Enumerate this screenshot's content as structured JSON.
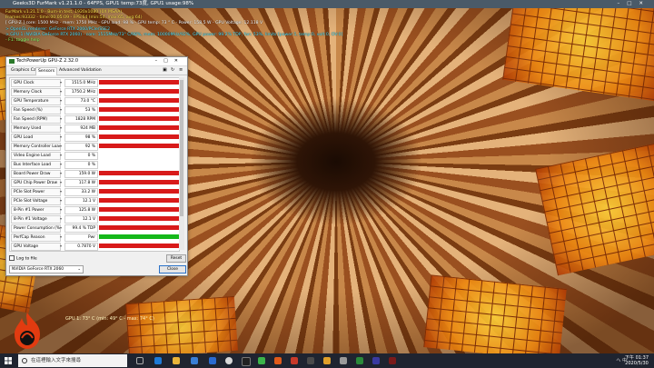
{
  "furmark": {
    "window_title": "Geeks3D FurMark v1.21.1.0 - 64FPS, GPU1 temp:73度, GPU1 usage:98%",
    "info_lines": [
      "FurMark v1.21.1.0 - Burn-in test, 1920x1080 (0X MSAA)",
      "Frames:93332 - time:00:05:09 - FPS:64 (min:54, max:65, avg:64)",
      "[ GPU-Z ] core: 1500 MHz - mem: 1750 MHz - GPU load: 98 % - GPU temp: 73 ° C - Power: 158.5 W - GPU Voltage: 12.118 V",
      "> OpenGL renderer: GeForce RTX 2060/PCIe/SSE2",
      "> GPU 1 (NVIDIA GeForce RTX 2060) - core: 1515MHz/73° C/98%, mem: 10000MHz/92%, GPU power: 99.2% TDP, fan: 53%, limits:[power:1, temp:0, volt:0, OV:0]",
      "- F1: toggle help"
    ],
    "gpu_overlay": "GPU 1: 73° C (min: 49° C - max: 74° C)"
  },
  "gpuz": {
    "title": "TechPowerUp GPU-Z 2.32.0",
    "tabs": [
      "Graphics Card",
      "Sensors",
      "Advanced",
      "Validation"
    ],
    "active_tab": "Sensors",
    "sensors": [
      {
        "label": "GPU Clock",
        "value": "1515.0 MHz",
        "fill": 0.98
      },
      {
        "label": "Memory Clock",
        "value": "1750.2 MHz",
        "fill": 0.98
      },
      {
        "label": "GPU Temperature",
        "value": "73.0 °C",
        "fill": 0.98
      },
      {
        "label": "Fan Speed (%)",
        "value": "53 %",
        "fill": 0.98
      },
      {
        "label": "Fan Speed (RPM)",
        "value": "1828 RPM",
        "fill": 0.98
      },
      {
        "label": "Memory Used",
        "value": "924 MB",
        "fill": 0.98
      },
      {
        "label": "GPU Load",
        "value": "98 %",
        "fill": 0.98
      },
      {
        "label": "Memory Controller Load",
        "value": "92 %",
        "fill": 0.98
      },
      {
        "label": "Video Engine Load",
        "value": "0 %",
        "fill": 0
      },
      {
        "label": "Bus Interface Load",
        "value": "0 %",
        "fill": 0
      },
      {
        "label": "Board Power Draw",
        "value": "159.0 W",
        "fill": 0.98
      },
      {
        "label": "GPU Chip Power Draw",
        "value": "117.8 W",
        "fill": 0.98
      },
      {
        "label": "PCIe Slot Power",
        "value": "33.2 W",
        "fill": 0.98
      },
      {
        "label": "PCIe Slot Voltage",
        "value": "12.1 V",
        "fill": 0.98
      },
      {
        "label": "8-Pin #1 Power",
        "value": "125.8 W",
        "fill": 0.98
      },
      {
        "label": "8-Pin #1 Voltage",
        "value": "12.1 V",
        "fill": 0.98
      },
      {
        "label": "Power Consumption (%)",
        "value": "99.4 % TDP",
        "fill": 0.98
      },
      {
        "label": "PerfCap Reason",
        "value": "Pwr",
        "fill": 0.98,
        "green": true
      },
      {
        "label": "GPU Voltage",
        "value": "0.7870 V",
        "fill": 0.98
      }
    ],
    "log_label": "Log to file",
    "reset_label": "Reset",
    "gpu_select": "NVIDIA GeForce RTX 2060",
    "close_label": "Close",
    "bar_color": "#d81a1a",
    "perfcap_color": "#16b81a"
  },
  "taskbar": {
    "search_placeholder": "在這裡輸入文字來搜尋",
    "tray_text": "へ 中",
    "time": "下午 01:37",
    "date": "2020/5/30"
  }
}
